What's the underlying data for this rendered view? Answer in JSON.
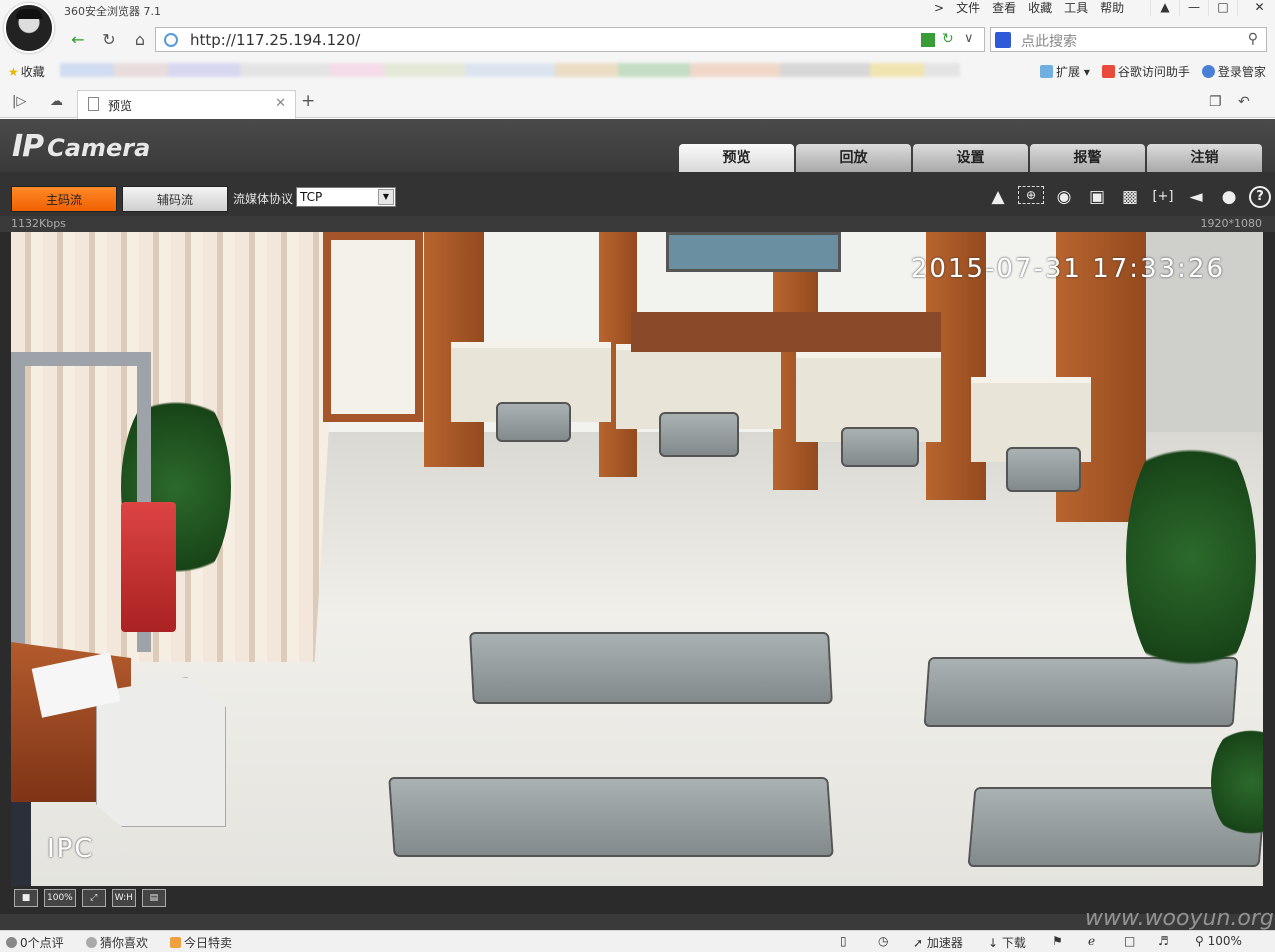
{
  "browser": {
    "app_title": "360安全浏览器 7.1",
    "menu": [
      "文件",
      "查看",
      "收藏",
      "工具",
      "帮助"
    ],
    "window_buttons": [
      "minimize-icon",
      "maximize-icon",
      "close-icon"
    ],
    "url": "http://117.25.194.120/",
    "search_placeholder": "点此搜索",
    "bookmarks_label": "收藏",
    "bookmarks_right": [
      "扩展",
      "谷歌访问助手",
      "登录管家"
    ],
    "tab": {
      "label": "预览"
    }
  },
  "camera": {
    "logo_ip": "IP",
    "logo_camera": "Camera",
    "tabs": [
      {
        "label": "预览",
        "active": true
      },
      {
        "label": "回放",
        "active": false
      },
      {
        "label": "设置",
        "active": false
      },
      {
        "label": "报警",
        "active": false
      },
      {
        "label": "注销",
        "active": false
      }
    ],
    "main_stream": "主码流",
    "sub_stream": "辅码流",
    "protocol_label": "流媒体协议",
    "protocol_value": "TCP",
    "bitrate": "1132Kbps",
    "resolution": "1920*1080",
    "timestamp": "2015-07-31 17:33:26",
    "osd_label": "IPC",
    "toolbar_icons": [
      "alarm-icon",
      "zoom-region-icon",
      "snapshot-icon",
      "multi-snapshot-icon",
      "record-icon",
      "fullscreen-icon",
      "volume-icon",
      "microphone-icon",
      "help-icon"
    ],
    "video_toolbar": [
      "100%",
      "W:H"
    ]
  },
  "status_bar": {
    "comments": "0个点评",
    "guess": "猜你喜欢",
    "deals": "今日特卖",
    "accelerator": "加速器",
    "download": "下载",
    "zoom": "100%"
  },
  "watermark": "www.wooyun.org",
  "colors": {
    "main_stream": "#f06000",
    "camera_bg": "#2b2b2b",
    "header_bg": "#404040"
  }
}
